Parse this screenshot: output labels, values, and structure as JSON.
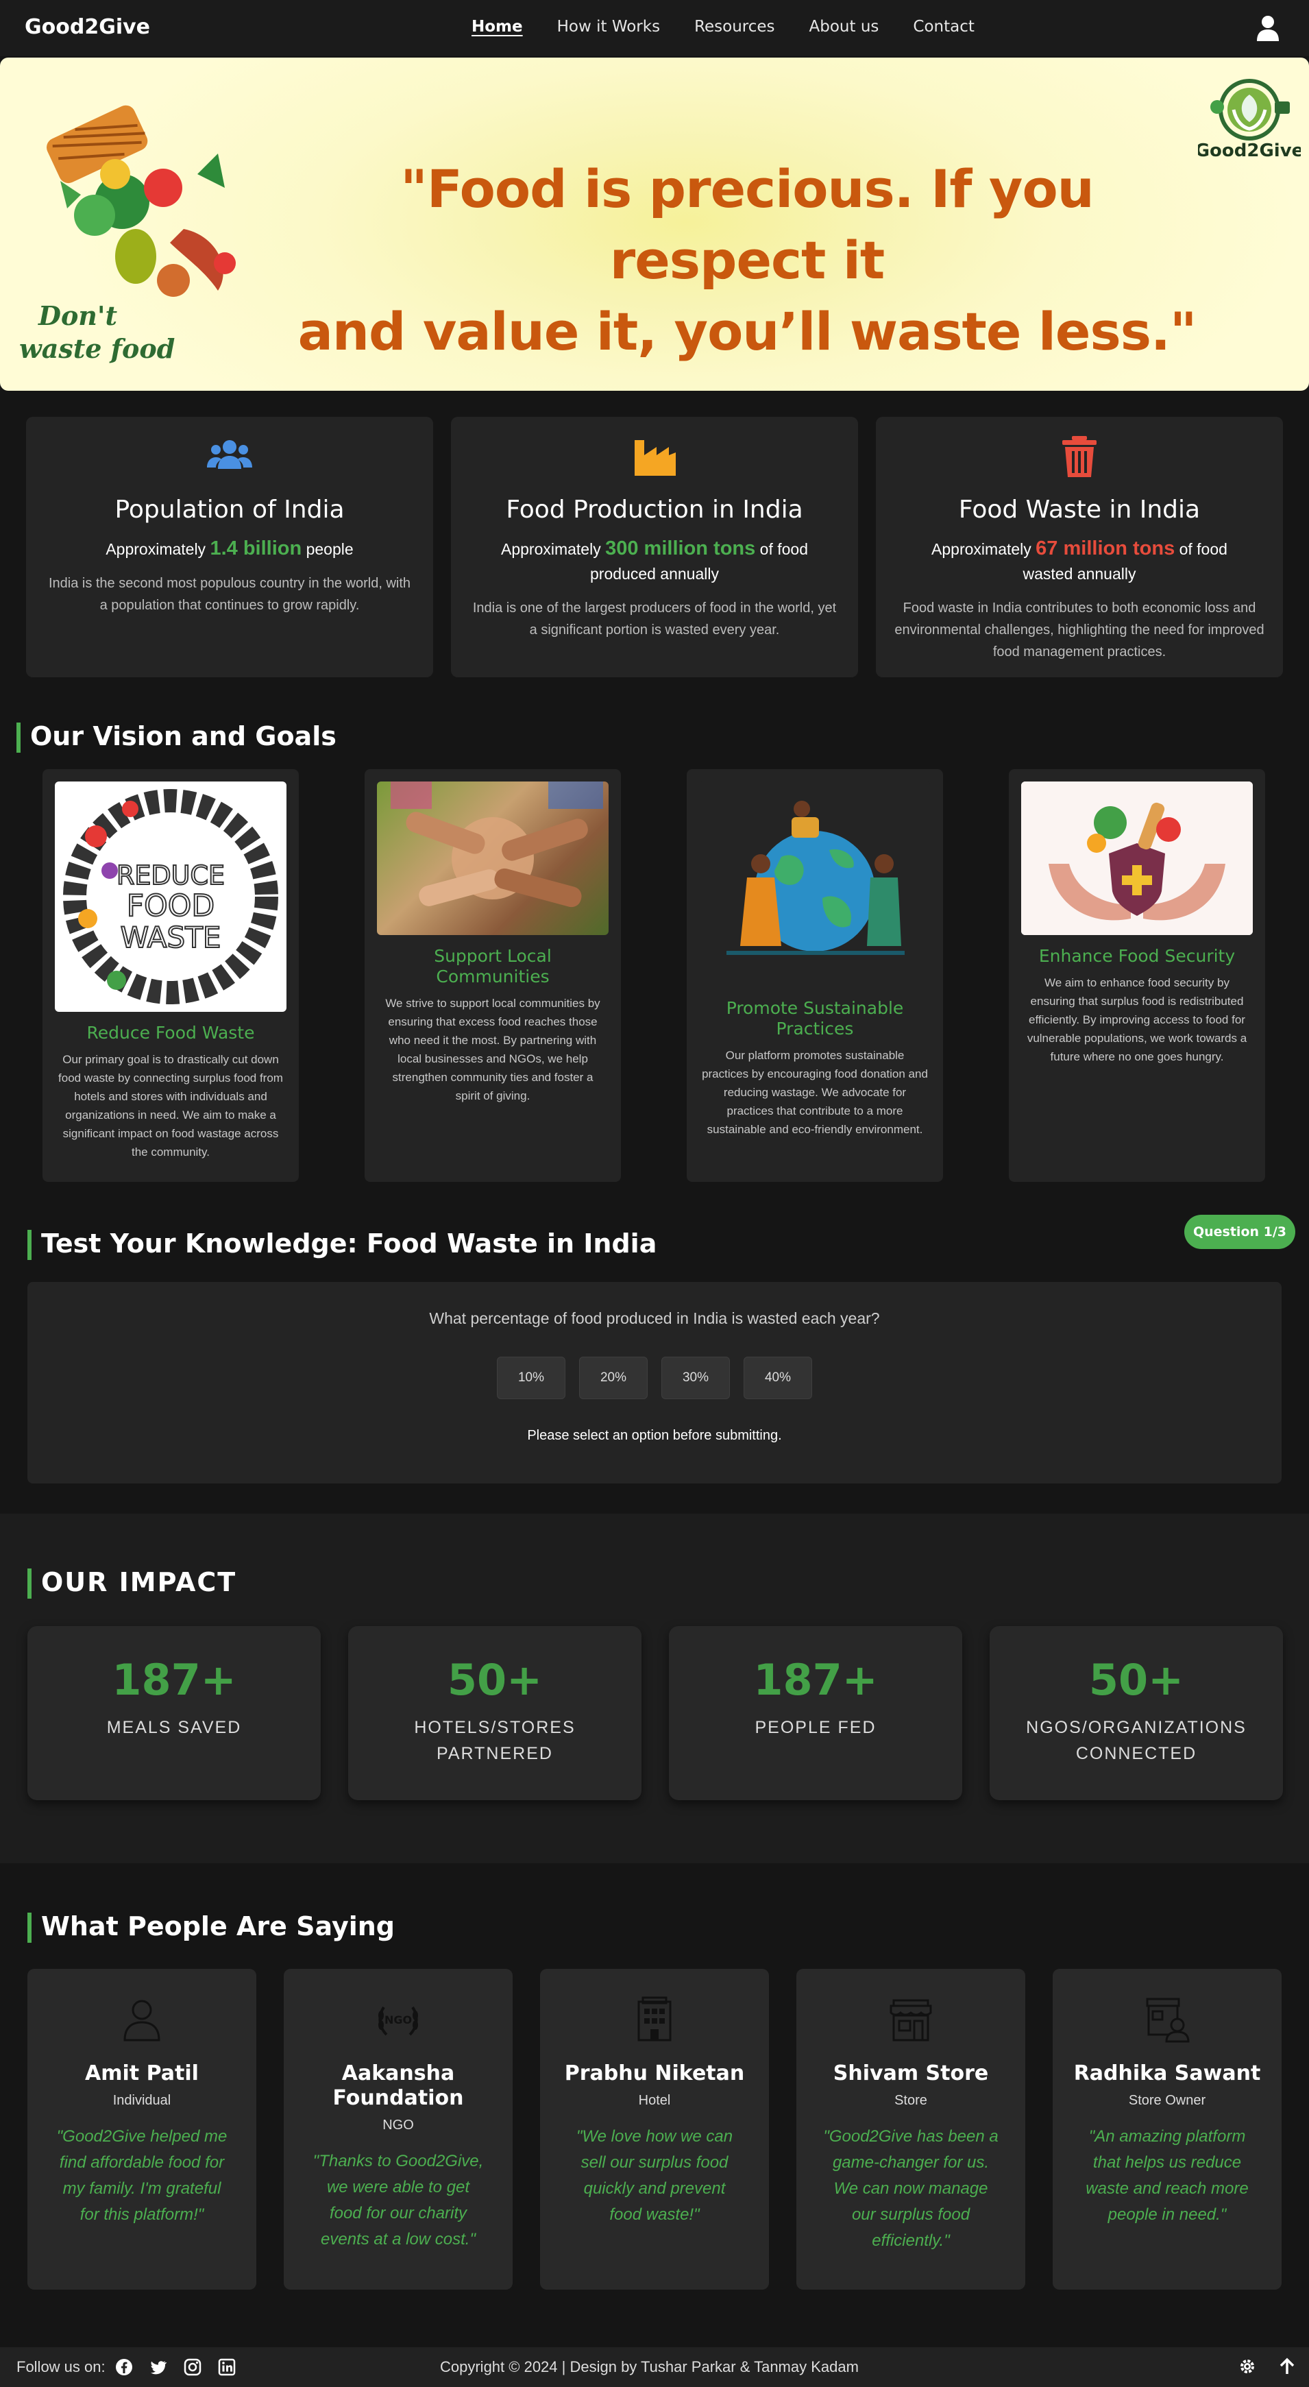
{
  "nav": {
    "brand": "Good2Give",
    "links": [
      "Home",
      "How it Works",
      "Resources",
      "About us",
      "Contact"
    ],
    "active": "Home",
    "user_icon": "user-icon"
  },
  "hero": {
    "quote_line1": "\"Food is precious. If you respect it",
    "quote_line2": "and value it, you’ll waste less.\"",
    "art_text_line1": "Don't",
    "art_text_line2": "waste food",
    "logo_text": "Good2Give",
    "slide_count": 5,
    "active_slide": 3
  },
  "stats": [
    {
      "icon": "users-icon",
      "title": "Population of India",
      "prefix": "Approximately",
      "highlight": "1.4 billion",
      "suffix": "people",
      "color": "#4caf50",
      "desc": "India is the second most populous country in the world, with a population that continues to grow rapidly."
    },
    {
      "icon": "factory-icon",
      "title": "Food Production in India",
      "prefix": "Approximately",
      "highlight": "300 million tons",
      "suffix": "of food produced annually",
      "color": "#4caf50",
      "desc": "India is one of the largest producers of food in the world, yet a significant portion is wasted every year."
    },
    {
      "icon": "trash-icon",
      "title": "Food Waste in India",
      "prefix": "Approximately",
      "highlight": "67 million tons",
      "suffix": "of food wasted annually",
      "color": "#e74c3c",
      "desc": "Food waste in India contributes to both economic loss and environmental challenges, highlighting the need for improved food management practices."
    }
  ],
  "vision": {
    "title": "Our Vision and Goals",
    "image_text": [
      "REDUCE",
      "FOOD",
      "WASTE"
    ],
    "cards": [
      {
        "title": "Reduce Food Waste",
        "desc": "Our primary goal is to drastically cut down food waste by connecting surplus food from hotels and stores with individuals and organizations in need. We aim to make a significant impact on food wastage across the community."
      },
      {
        "title": "Support Local Communities",
        "desc": "We strive to support local communities by ensuring that excess food reaches those who need it the most. By partnering with local businesses and NGOs, we help strengthen community ties and foster a spirit of giving."
      },
      {
        "title": "Promote Sustainable Practices",
        "desc": "Our platform promotes sustainable practices by encouraging food donation and reducing wastage. We advocate for practices that contribute to a more sustainable and eco-friendly environment."
      },
      {
        "title": "Enhance Food Security",
        "desc": "We aim to enhance food security by ensuring that surplus food is redistributed efficiently. By improving access to food for vulnerable populations, we work towards a future where no one goes hungry."
      }
    ]
  },
  "quiz": {
    "title": "Test Your Knowledge: Food Waste in India",
    "badge": "Question 1/3",
    "question": "What percentage of food produced in India is wasted each year?",
    "options": [
      "10%",
      "20%",
      "30%",
      "40%"
    ],
    "hint": "Please select an option before submitting."
  },
  "impact": {
    "title": "OUR IMPACT",
    "items": [
      {
        "num": "187+",
        "label1": "MEALS SAVED",
        "label2": ""
      },
      {
        "num": "50+",
        "label1": "HOTELS/STORES",
        "label2": "PARTNERED"
      },
      {
        "num": "187+",
        "label1": "PEOPLE FED",
        "label2": ""
      },
      {
        "num": "50+",
        "label1": "NGOS/ORGANIZATIONS",
        "label2": "CONNECTED"
      }
    ]
  },
  "testimonials": {
    "title": "What People Are Saying",
    "ngo_icon_text": "NGO",
    "items": [
      {
        "icon": "person-icon",
        "name": "Amit Patil",
        "role": "Individual",
        "quote": "\"Good2Give helped me find affordable food for my family. I'm grateful for this platform!\""
      },
      {
        "icon": "ngo-laurel-icon",
        "name": "Aakansha Foundation",
        "role": "NGO",
        "quote": "\"Thanks to Good2Give, we were able to get food for our charity events at a low cost.\""
      },
      {
        "icon": "hotel-icon",
        "name": "Prabhu Niketan",
        "role": "Hotel",
        "quote": "\"We love how we can sell our surplus food quickly and prevent food waste!\""
      },
      {
        "icon": "store-icon",
        "name": "Shivam Store",
        "role": "Store",
        "quote": "\"Good2Give has been a game-changer for us. We can now manage our surplus food efficiently.\""
      },
      {
        "icon": "store-owner-icon",
        "name": "Radhika Sawant",
        "role": "Store Owner",
        "quote": "\"An amazing platform that helps us reduce waste and reach more people in need.\""
      }
    ]
  },
  "footer": {
    "follow": "Follow us on:",
    "socials": [
      "facebook-icon",
      "twitter-icon",
      "instagram-icon",
      "linkedin-icon"
    ],
    "copyright": "Copyright © 2024 | Design by Tushar Parkar & Tanmay Kadam"
  },
  "colors": {
    "accent": "#4caf50",
    "danger": "#e74c3c",
    "hero_text": "#c9580e",
    "background": "#151515",
    "card": "#242424"
  }
}
